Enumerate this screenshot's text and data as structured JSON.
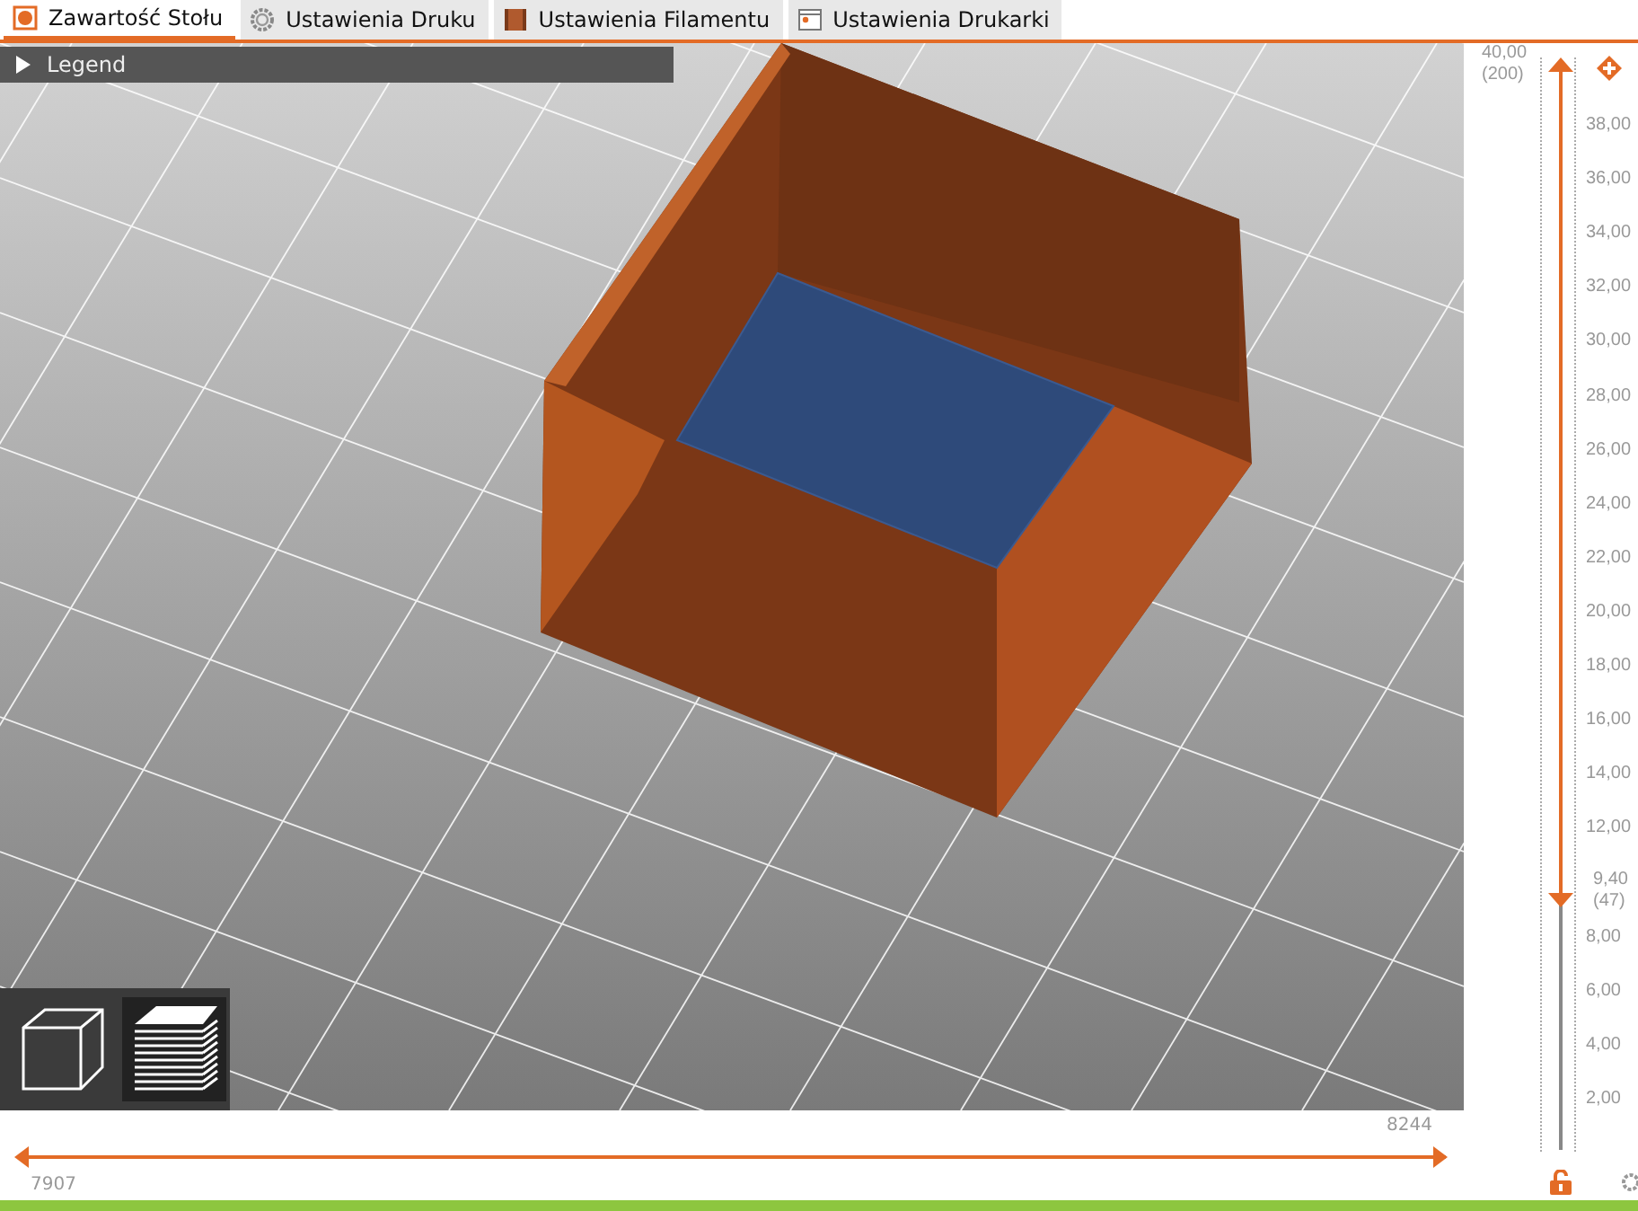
{
  "tabs": [
    {
      "label": "Zawartość Stołu",
      "selected": true,
      "kind": "plater"
    },
    {
      "label": "Ustawienia Druku",
      "selected": false,
      "kind": "print"
    },
    {
      "label": "Ustawienia Filamentu",
      "selected": false,
      "kind": "filament"
    },
    {
      "label": "Ustawienia Drukarki",
      "selected": false,
      "kind": "printer"
    }
  ],
  "legend": {
    "label": "Legend",
    "expanded": false
  },
  "view_buttons": [
    {
      "kind": "cube",
      "selected": false
    },
    {
      "kind": "layers",
      "selected": true
    }
  ],
  "layer_slider": {
    "upper": {
      "label": "40,00",
      "sublabel": "(200)",
      "level": 1
    },
    "lower": {
      "label": "9,40",
      "sublabel": "(47)",
      "level": 0.235
    },
    "ticks": [
      "38,00",
      "36,00",
      "34,00",
      "32,00",
      "30,00",
      "28,00",
      "26,00",
      "24,00",
      "22,00",
      "20,00",
      "18,00",
      "16,00",
      "14,00",
      "12,00",
      "8,00",
      "6,00",
      "4,00",
      "2,00"
    ]
  },
  "move_slider": {
    "lower": {
      "label": "7907",
      "level": 0
    },
    "upper": {
      "label": "8244",
      "level": 1
    }
  }
}
